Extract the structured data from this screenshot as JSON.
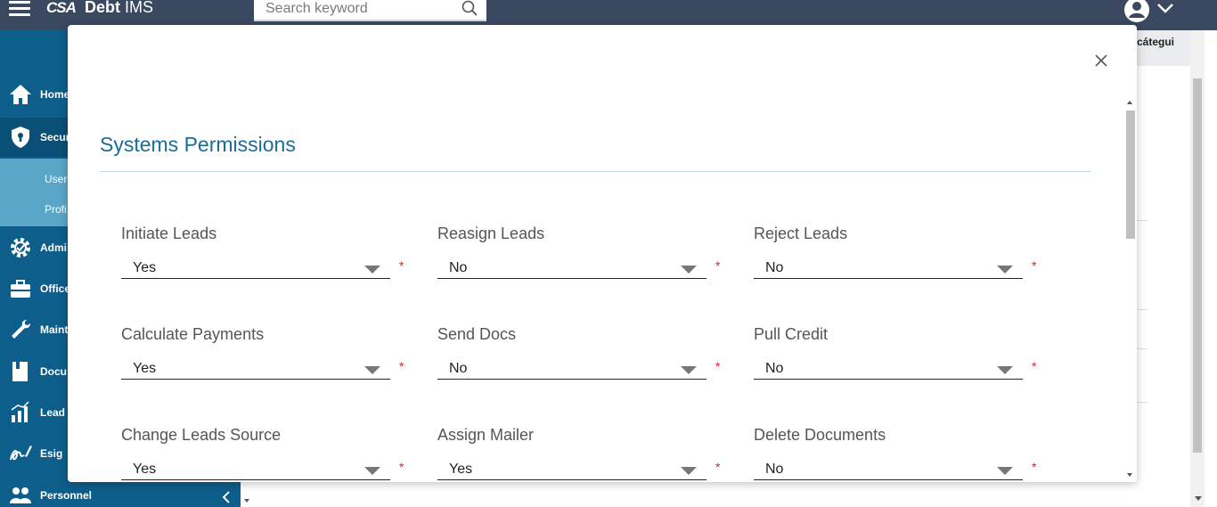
{
  "header": {
    "logo_text": "CSA",
    "app_title_bold": "Debt",
    "app_title_rest": " IMS",
    "search_placeholder": "Search keyword",
    "search_icon": "search-icon",
    "avatar_icon": "user-avatar-icon"
  },
  "sidebar": {
    "items": [
      {
        "label": "Home",
        "icon": "home-icon"
      },
      {
        "label": "Secur",
        "icon": "shield-icon"
      },
      {
        "label": "Admi",
        "icon": "gear-icon"
      },
      {
        "label": "Office",
        "icon": "briefcase-icon"
      },
      {
        "label": "Maint",
        "icon": "wrench-icon"
      },
      {
        "label": "Docu",
        "icon": "book-icon"
      },
      {
        "label": "Lead",
        "icon": "bar-chart-icon"
      },
      {
        "label": "Esig",
        "icon": "signature-icon"
      },
      {
        "label": "Personnel",
        "icon": "people-icon"
      }
    ],
    "sub_items": [
      "User",
      "Profi"
    ]
  },
  "background": {
    "user_name": "zcátegui"
  },
  "modal": {
    "title": "Systems Permissions",
    "required_mark": "*",
    "fields": [
      {
        "label": "Initiate Leads",
        "value": "Yes"
      },
      {
        "label": "Reasign Leads",
        "value": "No"
      },
      {
        "label": "Reject Leads",
        "value": "No"
      },
      {
        "label": "Calculate Payments",
        "value": "Yes"
      },
      {
        "label": "Send Docs",
        "value": "No"
      },
      {
        "label": "Pull Credit",
        "value": "No"
      },
      {
        "label": "Change Leads Source",
        "value": "Yes"
      },
      {
        "label": "Assign Mailer",
        "value": "Yes"
      },
      {
        "label": "Delete Documents",
        "value": "No"
      }
    ]
  },
  "colors": {
    "topbar": "#3a4860",
    "sidebar": "#0d5e8a",
    "sidebar_sub": "#5aa6c8",
    "title": "#1a6c97",
    "required": "#e02020"
  }
}
